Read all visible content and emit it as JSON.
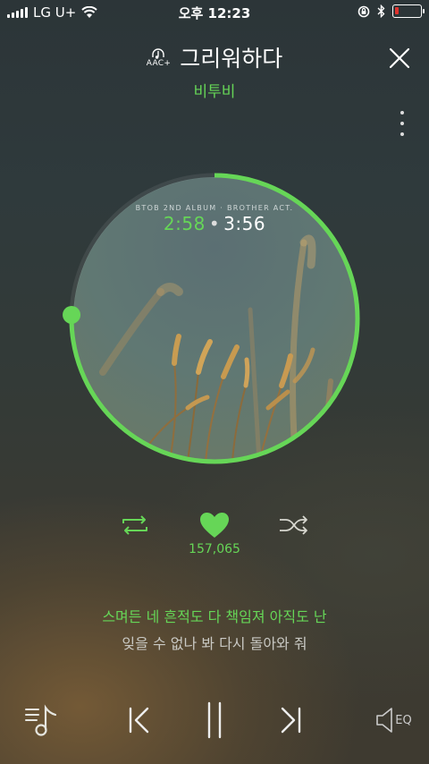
{
  "status_bar": {
    "carrier": "LG U+",
    "time": "오후 12:23",
    "battery_percent": 15,
    "icons": [
      "signal-icon",
      "wifi-icon",
      "rotation-lock-icon",
      "bluetooth-icon",
      "battery-icon"
    ]
  },
  "header": {
    "quality_badge": "AAC+",
    "title": "그리워하다",
    "artist": "비투비",
    "close_icon": "close-icon",
    "more_icon": "more-vertical-icon"
  },
  "player": {
    "album_caption": "BTOB 2ND ALBUM · BROTHER ACT.",
    "current_time": "2:58",
    "separator": "•",
    "total_time": "3:56",
    "progress_fraction": 0.754,
    "accent_color": "#66d657"
  },
  "actions": {
    "repeat_icon": "repeat-icon",
    "like_icon": "heart-icon",
    "like_count": "157,065",
    "shuffle_icon": "shuffle-icon"
  },
  "lyrics": {
    "current": "스며든 네 흔적도 다 책임져 아직도 난",
    "next": "잊을 수 없나 봐 다시 돌아와 줘"
  },
  "bottom_bar": {
    "playlist_icon": "playlist-icon",
    "prev_icon": "previous-icon",
    "pause_icon": "pause-icon",
    "next_icon": "next-icon",
    "eq_label": "EQ"
  }
}
